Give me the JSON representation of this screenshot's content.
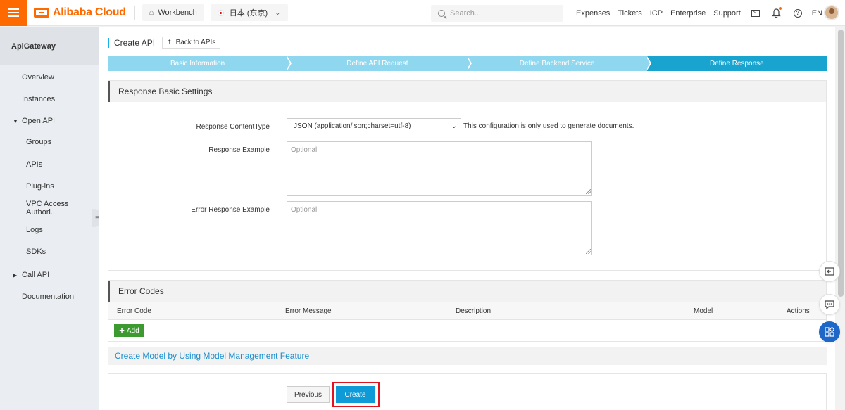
{
  "topbar": {
    "brand": "Alibaba Cloud",
    "workbench": "Workbench",
    "region": "日本 (东京)",
    "search_placeholder": "Search...",
    "links": [
      "Expenses",
      "Tickets",
      "ICP",
      "Enterprise",
      "Support"
    ],
    "language": "EN"
  },
  "sidebar": {
    "title": "ApiGateway",
    "items": [
      {
        "label": "Overview"
      },
      {
        "label": "Instances"
      },
      {
        "label": "Open API"
      },
      {
        "label": "Groups"
      },
      {
        "label": "APIs"
      },
      {
        "label": "Plug-ins"
      },
      {
        "label": "VPC Access Authori..."
      },
      {
        "label": "Logs"
      },
      {
        "label": "SDKs"
      },
      {
        "label": "Call API"
      },
      {
        "label": "Documentation"
      }
    ]
  },
  "main": {
    "title": "Create API",
    "back_label": "Back to APIs",
    "steps": [
      "Basic Information",
      "Define API Request",
      "Define Backend Service",
      "Define Response"
    ],
    "active_step": 3,
    "response_settings": {
      "heading": "Response Basic Settings",
      "content_type_label": "Response ContentType",
      "content_type_value": "JSON (application/json;charset=utf-8)",
      "content_type_hint": "This configuration is only used to generate documents.",
      "example_label": "Response Example",
      "example_placeholder": "Optional",
      "error_example_label": "Error Response Example",
      "error_example_placeholder": "Optional"
    },
    "error_codes": {
      "heading": "Error Codes",
      "columns": [
        "Error Code",
        "Error Message",
        "Description",
        "Model",
        "Actions"
      ],
      "add_label": "Add"
    },
    "model_link": "Create Model by Using Model Management Feature",
    "previous_label": "Previous",
    "create_label": "Create"
  },
  "colors": {
    "brand": "#ff6a00",
    "step_active": "#19a3cf",
    "step_inactive": "#8fd7ef",
    "primary_button": "#0d9ad6",
    "add_button": "#3c9a30",
    "highlight": "#e0141e"
  }
}
